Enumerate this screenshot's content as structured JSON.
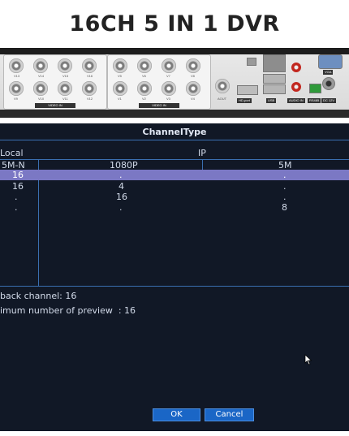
{
  "product_title": "16CH 5 IN 1 DVR",
  "panel": {
    "video_in_label_left": "VIDEO IN",
    "video_in_label_right": "VIDEO IN",
    "bnc_labels_row1": [
      "V13",
      "V14",
      "V15",
      "V16",
      "V5",
      "V6",
      "V7",
      "V8"
    ],
    "bnc_labels_row2": [
      "V9",
      "V10",
      "V11",
      "V12",
      "V1",
      "V2",
      "V3",
      "V4"
    ],
    "audio_out": "AOUT",
    "hdmi_label": "HD-port",
    "usb_label": "USB",
    "audio_in_label": "AUDIO IN",
    "rs485_label": "RS485",
    "dc_label": "DC 12V",
    "vga_label": "VGA"
  },
  "dialog": {
    "title": "ChannelType",
    "local_label": "Local",
    "ip_label": "IP",
    "columns": [
      "5M-N",
      "1080P",
      "5M"
    ],
    "rows": [
      [
        ".",
        ".",
        "."
      ],
      [
        "16",
        ".",
        "."
      ],
      [
        "16",
        "4",
        "."
      ],
      [
        ".",
        "16",
        "."
      ],
      [
        ".",
        ".",
        "8"
      ]
    ],
    "playback_text": "back channel: 16",
    "preview_text": "imum number of preview  : 16",
    "ok_label": "OK",
    "cancel_label": "Cancel"
  },
  "colors": {
    "dialog_bg": "#111826",
    "grid_line": "#3a6fb0",
    "selected_row": "#7b78c4",
    "button": "#1a66c6"
  }
}
